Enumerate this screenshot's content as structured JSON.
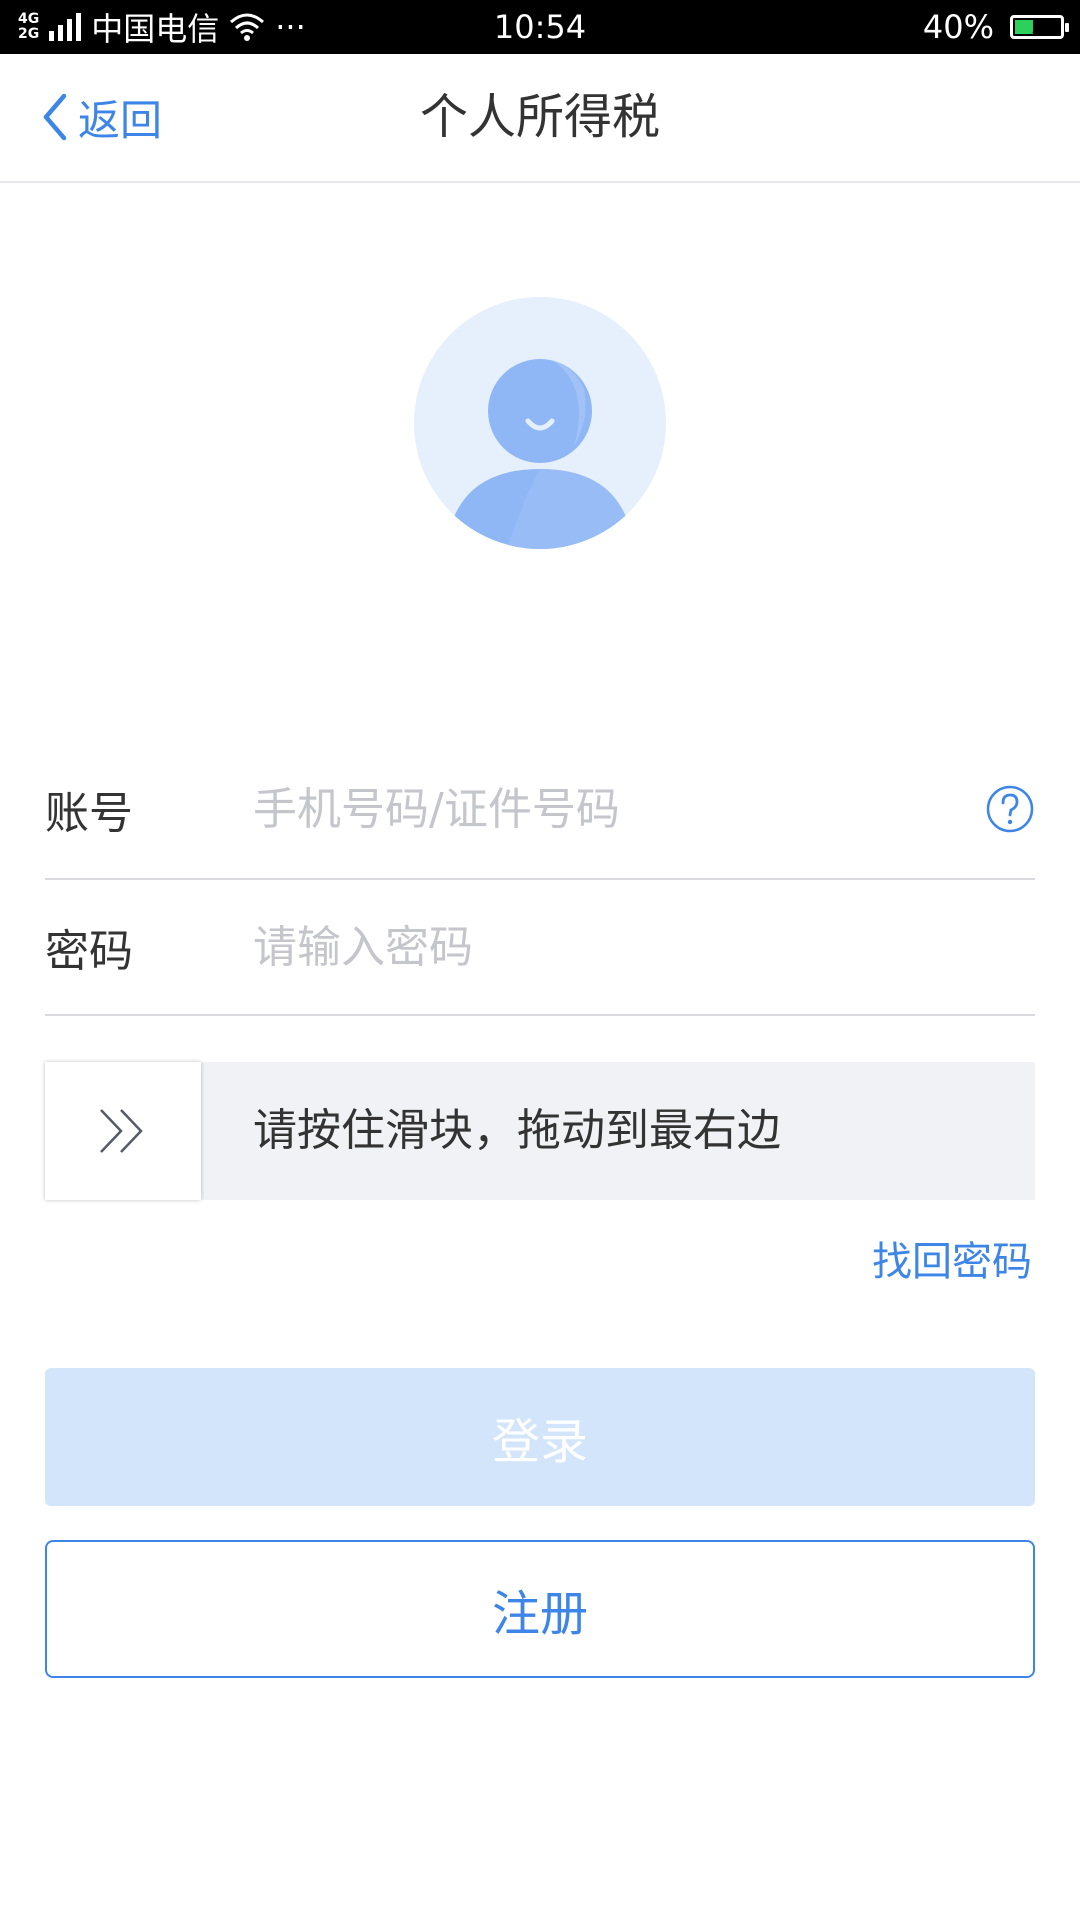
{
  "status_bar": {
    "network_top": "4G",
    "network_bottom": "2G",
    "carrier": "中国电信",
    "more": "···",
    "time": "10:54",
    "battery": "40%",
    "battery_level": 0.4
  },
  "nav": {
    "back_label": "返回",
    "title": "个人所得税"
  },
  "form": {
    "account_label": "账号",
    "account_placeholder": "手机号码/证件号码",
    "password_label": "密码",
    "password_placeholder": "请输入密码"
  },
  "slider": {
    "hint": "请按住滑块，拖动到最右边"
  },
  "links": {
    "forgot_password": "找回密码"
  },
  "buttons": {
    "login": "登录",
    "register": "注册"
  },
  "colors": {
    "accent": "#3d86e8",
    "login_disabled_bg": "#d2e5fa",
    "avatar_bg": "#e6f0fd",
    "avatar_figure": "#8fb6f5"
  }
}
